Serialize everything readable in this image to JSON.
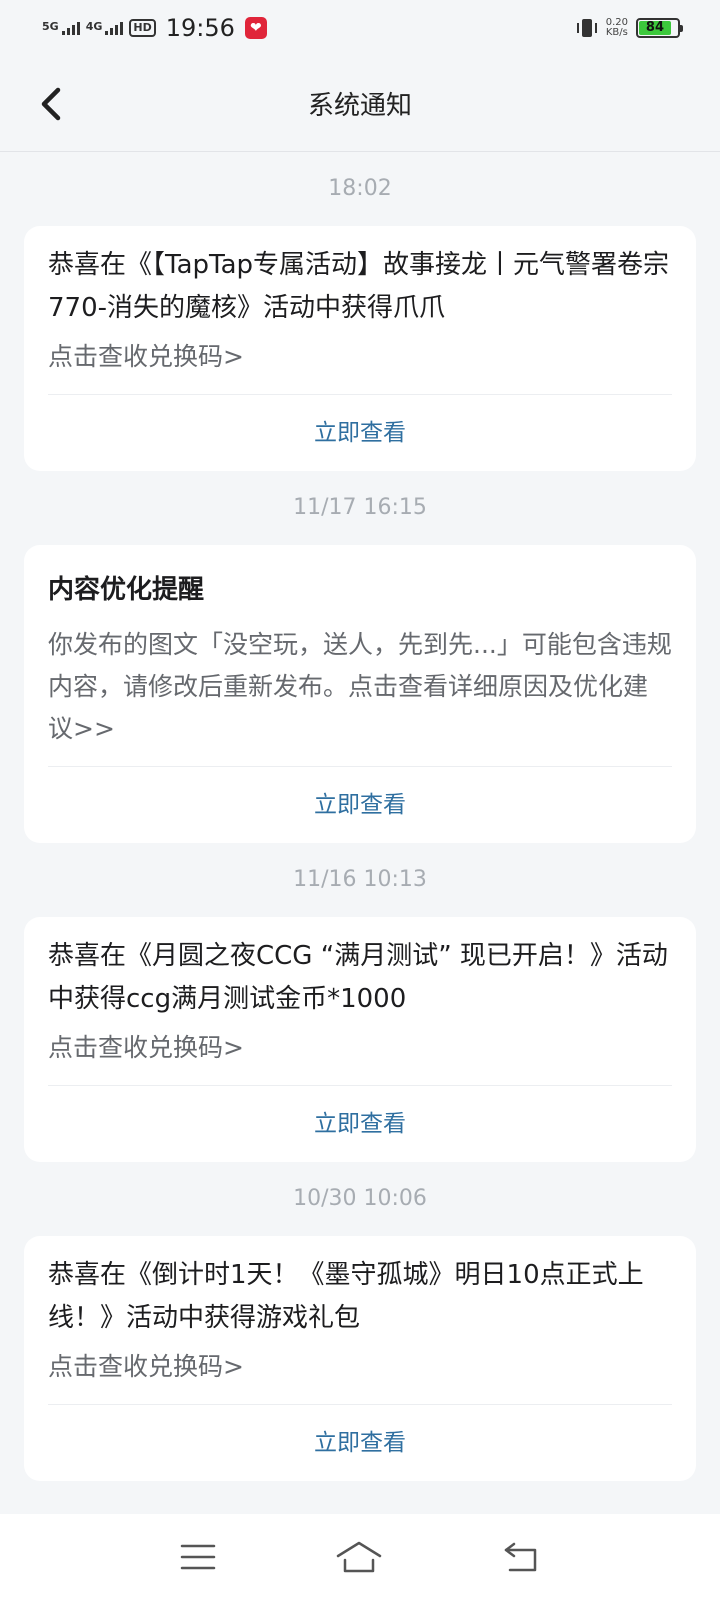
{
  "status_bar": {
    "net1": "5G",
    "net2": "4G",
    "hd": "HD",
    "time": "19:56",
    "speed_value": "0.20",
    "speed_unit": "KB/s",
    "battery": "84"
  },
  "header": {
    "title": "系统通知"
  },
  "notifications": [
    {
      "timestamp": "18:02",
      "title": "恭喜在《【TapTap专属活动】故事接龙丨元气警署卷宗770-消失的魔核》活动中获得爪爪",
      "body": "点击查收兑换码>",
      "action": "立即查看"
    },
    {
      "timestamp": "11/17  16:15",
      "title": "内容优化提醒",
      "body": "你发布的图文「没空玩，送人，先到先...」可能包含违规内容，请修改后重新发布。点击查看详细原因及优化建议>>",
      "action": "立即查看"
    },
    {
      "timestamp": "11/16  10:13",
      "title": "恭喜在《月圆之夜CCG “满月测试” 现已开启！》活动中获得ccg满月测试金币*1000",
      "body": "点击查收兑换码>",
      "action": "立即查看"
    },
    {
      "timestamp": "10/30  10:06",
      "title": "恭喜在《倒计时1天！《墨守孤城》明日10点正式上线！》活动中获得游戏礼包",
      "body": "点击查收兑换码>",
      "action": "立即查看"
    }
  ],
  "nav": {
    "icons": [
      "menu-icon",
      "home-icon",
      "back-icon"
    ]
  },
  "colors": {
    "background": "#f4f6f8",
    "card": "#ffffff",
    "action_link": "#2f6fa0",
    "timestamp": "#a7acb2",
    "battery": "#3cc83c"
  }
}
